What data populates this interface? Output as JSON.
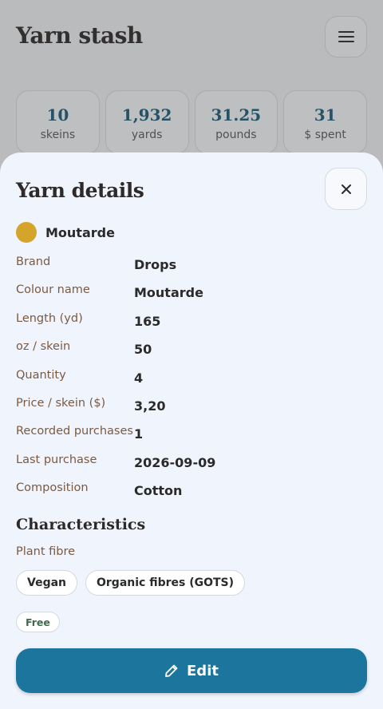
{
  "app": {
    "title": "Yarn stash",
    "stats": [
      {
        "value": "10",
        "label": "skeins"
      },
      {
        "value": "1,932",
        "label": "yards"
      },
      {
        "value": "31.25",
        "label": "pounds"
      },
      {
        "value": "31",
        "label": "$ spent"
      }
    ]
  },
  "sheet": {
    "title": "Yarn details",
    "swatch": {
      "name": "Moutarde",
      "color": "#d4a52a"
    },
    "details": [
      {
        "label": "Brand",
        "value": "Drops"
      },
      {
        "label": "Colour name",
        "value": "Moutarde"
      },
      {
        "label": "Length (yd)",
        "value": "165"
      },
      {
        "label": "oz / skein",
        "value": "50"
      },
      {
        "label": "Quantity",
        "value": "4"
      },
      {
        "label": "Price / skein ($)",
        "value": "3,20"
      },
      {
        "label": "Recorded purchases",
        "value": "1"
      },
      {
        "label": "Last purchase",
        "value": "2026-09-09"
      },
      {
        "label": "Composition",
        "value": "Cotton"
      }
    ],
    "characteristics": {
      "title": "Characteristics",
      "subtitle": "Plant fibre",
      "chips": [
        "Vegan",
        "Organic fibres (GOTS)"
      ],
      "free_chip": "Free"
    },
    "edit_label": "Edit"
  },
  "colors": {
    "accent": "#1b759c",
    "label": "#7b5a42",
    "sheet_bg": "#eff4fd"
  },
  "icons": {
    "menu": "menu-icon",
    "close": "close-icon",
    "edit": "pencil-icon"
  }
}
